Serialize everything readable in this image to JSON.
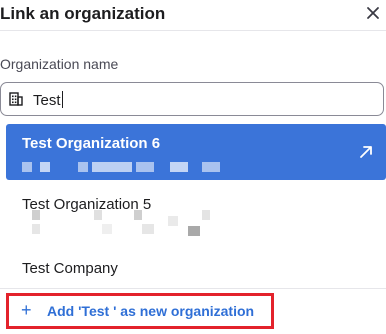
{
  "dialog": {
    "title": "Link an organization",
    "close_icon": "close-icon"
  },
  "field": {
    "label": "Organization name",
    "value": "Test",
    "icon": "building-icon"
  },
  "results": [
    {
      "name": "Test Organization 6",
      "highlighted": true,
      "action_icon": "open-arrow-icon",
      "subtitle_redacted": true
    },
    {
      "name": "Test Organization 5",
      "highlighted": false,
      "subtitle_redacted": true
    },
    {
      "name": "Test Company",
      "highlighted": false,
      "subtitle_redacted": false
    }
  ],
  "add_option": {
    "label": "Add 'Test ' as new organization",
    "icon": "plus-icon"
  },
  "colors": {
    "highlight": "#3b74d9",
    "accent": "#2f6fd6",
    "callout": "#e3222b"
  }
}
